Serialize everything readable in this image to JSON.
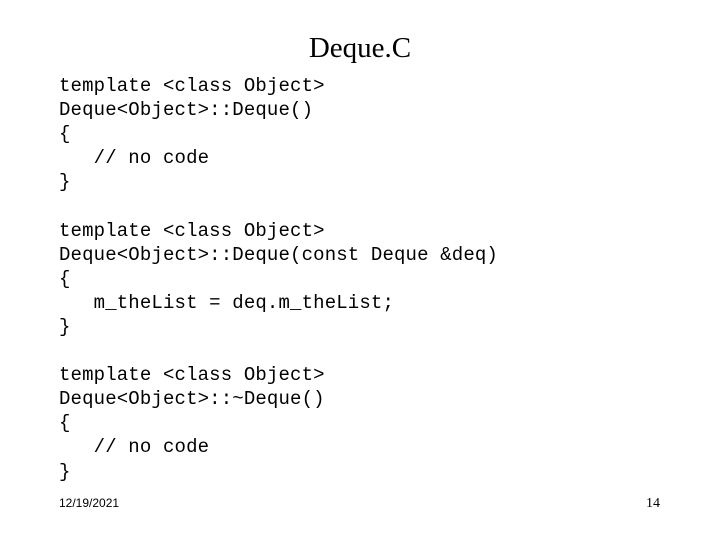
{
  "slide": {
    "title": "Deque.C",
    "code_lines": [
      "template <class Object>",
      "Deque<Object>::Deque()",
      "{",
      "   // no code",
      "}",
      "",
      "template <class Object>",
      "Deque<Object>::Deque(const Deque &deq)",
      "{",
      "   m_theList = deq.m_theList;",
      "}",
      "",
      "template <class Object>",
      "Deque<Object>::~Deque()",
      "{",
      "   // no code",
      "}"
    ],
    "footer": {
      "date": "12/19/2021",
      "page_number": "14"
    },
    "colors": {
      "background": "#ffffff",
      "text": "#000000"
    }
  }
}
